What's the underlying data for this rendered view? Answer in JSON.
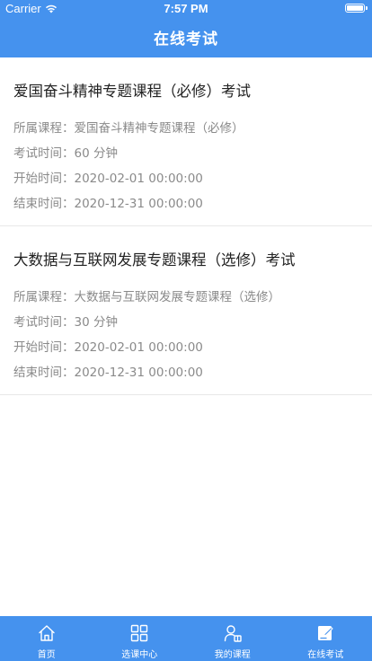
{
  "status_bar": {
    "carrier": "Carrier",
    "time": "7:57 PM"
  },
  "nav": {
    "title": "在线考试"
  },
  "exams": [
    {
      "title": "爱国奋斗精神专题课程（必修）考试",
      "rows": [
        "所属课程：爱国奋斗精神专题课程（必修）",
        "考试时间：60 分钟",
        "开始时间：2020-02-01 00:00:00",
        "结束时间：2020-12-31 00:00:00"
      ]
    },
    {
      "title": "大数据与互联网发展专题课程（选修）考试",
      "rows": [
        "所属课程：大数据与互联网发展专题课程（选修）",
        "考试时间：30 分钟",
        "开始时间：2020-02-01 00:00:00",
        "结束时间：2020-12-31 00:00:00"
      ]
    }
  ],
  "tabbar": {
    "items": [
      {
        "label": "首页",
        "icon": "home-icon"
      },
      {
        "label": "选课中心",
        "icon": "grid-icon"
      },
      {
        "label": "我的课程",
        "icon": "user-book-icon"
      },
      {
        "label": "在线考试",
        "icon": "exam-edit-icon",
        "active": true
      }
    ]
  },
  "colors": {
    "primary": "#4592ee",
    "title_text": "#222222",
    "info_text": "#8a8a8a",
    "divider": "#e8e8e8"
  }
}
